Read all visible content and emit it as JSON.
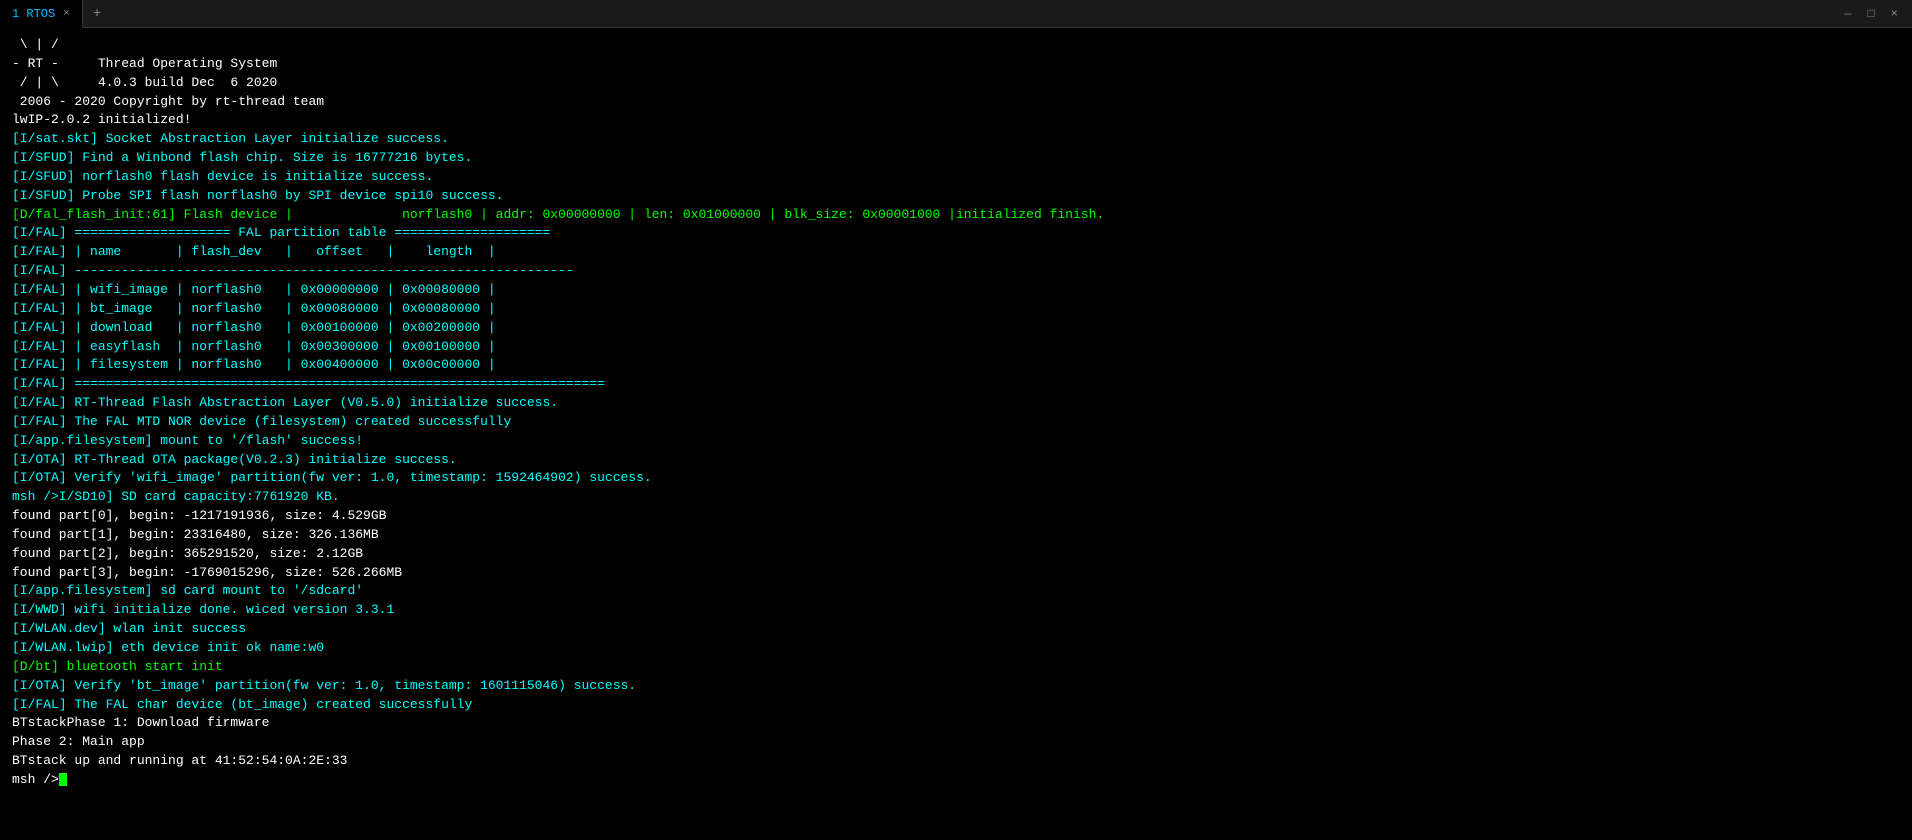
{
  "titlebar": {
    "tab_label": "1 RTOS",
    "tab_close": "×",
    "tab_add": "+",
    "ctrl_minimize": "—",
    "ctrl_maximize": "□",
    "ctrl_close": "×"
  },
  "terminal": {
    "lines": [
      {
        "text": " \\ | /",
        "color": "white"
      },
      {
        "text": "- RT -     Thread Operating System",
        "color": "white"
      },
      {
        "text": " / | \\     4.0.3 build Dec  6 2020",
        "color": "white"
      },
      {
        "text": " 2006 - 2020 Copyright by rt-thread team",
        "color": "white"
      },
      {
        "text": "lwIP-2.0.2 initialized!",
        "color": "white"
      },
      {
        "text": "[I/sat.skt] Socket Abstraction Layer initialize success.",
        "color": "cyan"
      },
      {
        "text": "[I/SFUD] Find a Winbond flash chip. Size is 16777216 bytes.",
        "color": "cyan"
      },
      {
        "text": "[I/SFUD] norflash0 flash device is initialize success.",
        "color": "cyan"
      },
      {
        "text": "[I/SFUD] Probe SPI flash norflash0 by SPI device spi10 success.",
        "color": "cyan"
      },
      {
        "text": "[D/fal_flash_init:61] Flash device |              norflash0 | addr: 0x00000000 | len: 0x01000000 | blk_size: 0x00001000 |initialized finish.",
        "color": "green"
      },
      {
        "text": "[I/FAL] ==================== FAL partition table ====================",
        "color": "cyan"
      },
      {
        "text": "[I/FAL] | name       | flash_dev   |   offset   |    length  |",
        "color": "cyan"
      },
      {
        "text": "[I/FAL] ----------------------------------------------------------------",
        "color": "cyan"
      },
      {
        "text": "[I/FAL] | wifi_image | norflash0   | 0x00000000 | 0x00080000 |",
        "color": "cyan"
      },
      {
        "text": "[I/FAL] | bt_image   | norflash0   | 0x00080000 | 0x00080000 |",
        "color": "cyan"
      },
      {
        "text": "[I/FAL] | download   | norflash0   | 0x00100000 | 0x00200000 |",
        "color": "cyan"
      },
      {
        "text": "[I/FAL] | easyflash  | norflash0   | 0x00300000 | 0x00100000 |",
        "color": "cyan"
      },
      {
        "text": "[I/FAL] | filesystem | norflash0   | 0x00400000 | 0x00c00000 |",
        "color": "cyan"
      },
      {
        "text": "[I/FAL] ====================================================================",
        "color": "cyan"
      },
      {
        "text": "[I/FAL] RT-Thread Flash Abstraction Layer (V0.5.0) initialize success.",
        "color": "cyan"
      },
      {
        "text": "[I/FAL] The FAL MTD NOR device (filesystem) created successfully",
        "color": "cyan"
      },
      {
        "text": "[I/app.filesystem] mount to '/flash' success!",
        "color": "cyan"
      },
      {
        "text": "[I/OTA] RT-Thread OTA package(V0.2.3) initialize success.",
        "color": "cyan"
      },
      {
        "text": "[I/OTA] Verify 'wifi_image' partition(fw ver: 1.0, timestamp: 1592464902) success.",
        "color": "cyan"
      },
      {
        "text": "msh />I/SD10] SD card capacity:7761920 KB.",
        "color": "cyan"
      },
      {
        "text": "found part[0], begin: -1217191936, size: 4.529GB",
        "color": "white"
      },
      {
        "text": "found part[1], begin: 23316480, size: 326.136MB",
        "color": "white"
      },
      {
        "text": "found part[2], begin: 365291520, size: 2.12GB",
        "color": "white"
      },
      {
        "text": "found part[3], begin: -1769015296, size: 526.266MB",
        "color": "white"
      },
      {
        "text": "[I/app.filesystem] sd card mount to '/sdcard'",
        "color": "cyan"
      },
      {
        "text": "[I/WWD] wifi initialize done. wiced version 3.3.1",
        "color": "cyan"
      },
      {
        "text": "[I/WLAN.dev] wlan init success",
        "color": "cyan"
      },
      {
        "text": "[I/WLAN.lwip] eth device init ok name:w0",
        "color": "cyan"
      },
      {
        "text": "[D/bt] bluetooth start init",
        "color": "green"
      },
      {
        "text": "[I/OTA] Verify 'bt_image' partition(fw ver: 1.0, timestamp: 1601115046) success.",
        "color": "cyan"
      },
      {
        "text": "[I/FAL] The FAL char device (bt_image) created successfully",
        "color": "cyan"
      },
      {
        "text": "BTstackPhase 1: Download firmware",
        "color": "white"
      },
      {
        "text": "Phase 2: Main app",
        "color": "white"
      },
      {
        "text": "BTstack up and running at 41:52:54:0A:2E:33",
        "color": "white"
      },
      {
        "text": "",
        "color": "white"
      },
      {
        "text": "msh />",
        "color": "white"
      }
    ]
  }
}
